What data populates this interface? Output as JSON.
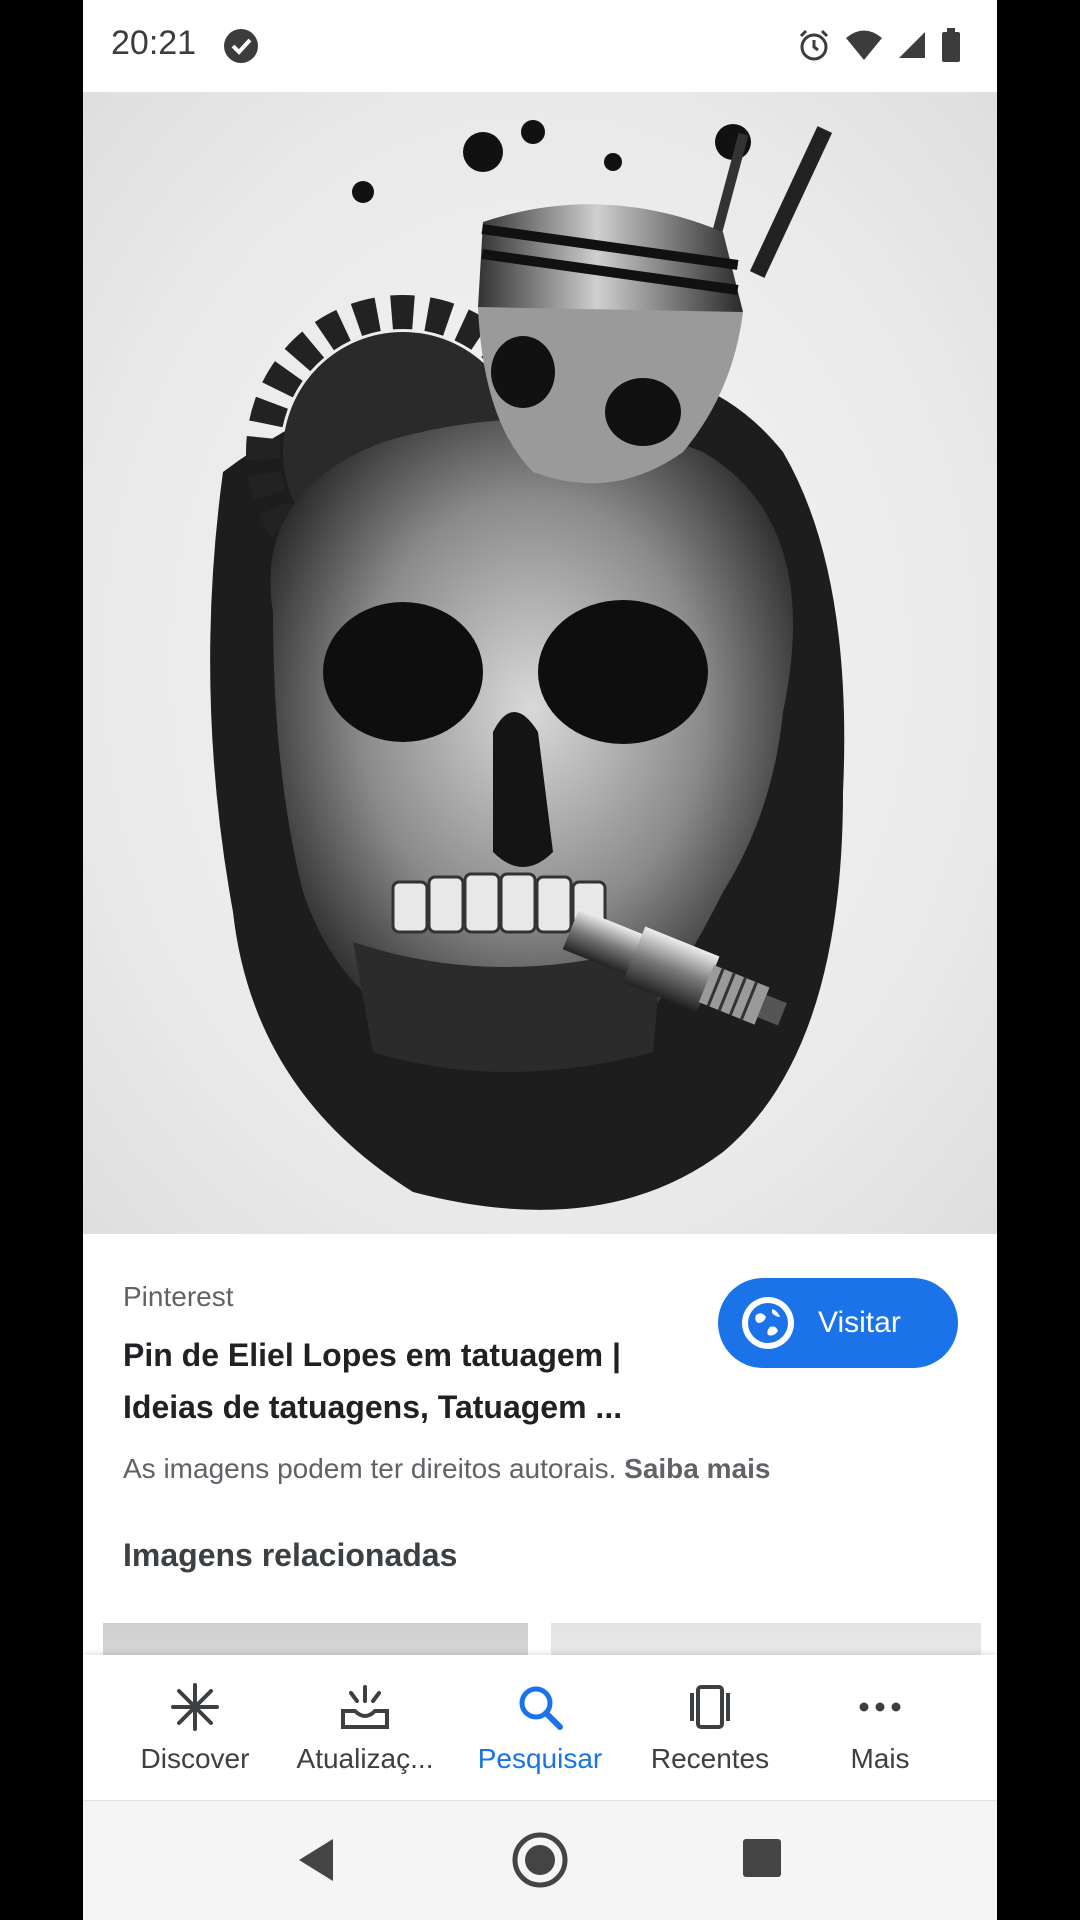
{
  "status_bar": {
    "time": "20:21"
  },
  "result": {
    "source": "Pinterest",
    "title": "Pin de Eliel Lopes em tatuagem | Ideias de tatuagens, Tatuagem ...",
    "visit_label": "Visitar",
    "copyright_text": "As imagens podem ter direitos autorais.",
    "learn_more": "Saiba mais"
  },
  "related": {
    "heading": "Imagens relacionadas"
  },
  "bottom_nav": {
    "items": [
      {
        "label": "Discover",
        "icon": "discover-asterisk-icon"
      },
      {
        "label": "Atualizaç...",
        "icon": "updates-tray-icon"
      },
      {
        "label": "Pesquisar",
        "icon": "search-icon"
      },
      {
        "label": "Recentes",
        "icon": "recent-cards-icon"
      },
      {
        "label": "Mais",
        "icon": "more-dots-icon"
      }
    ],
    "active_index": 2
  },
  "colors": {
    "accent": "#1a73e8",
    "text_primary": "#202124",
    "text_secondary": "#5f6368"
  }
}
